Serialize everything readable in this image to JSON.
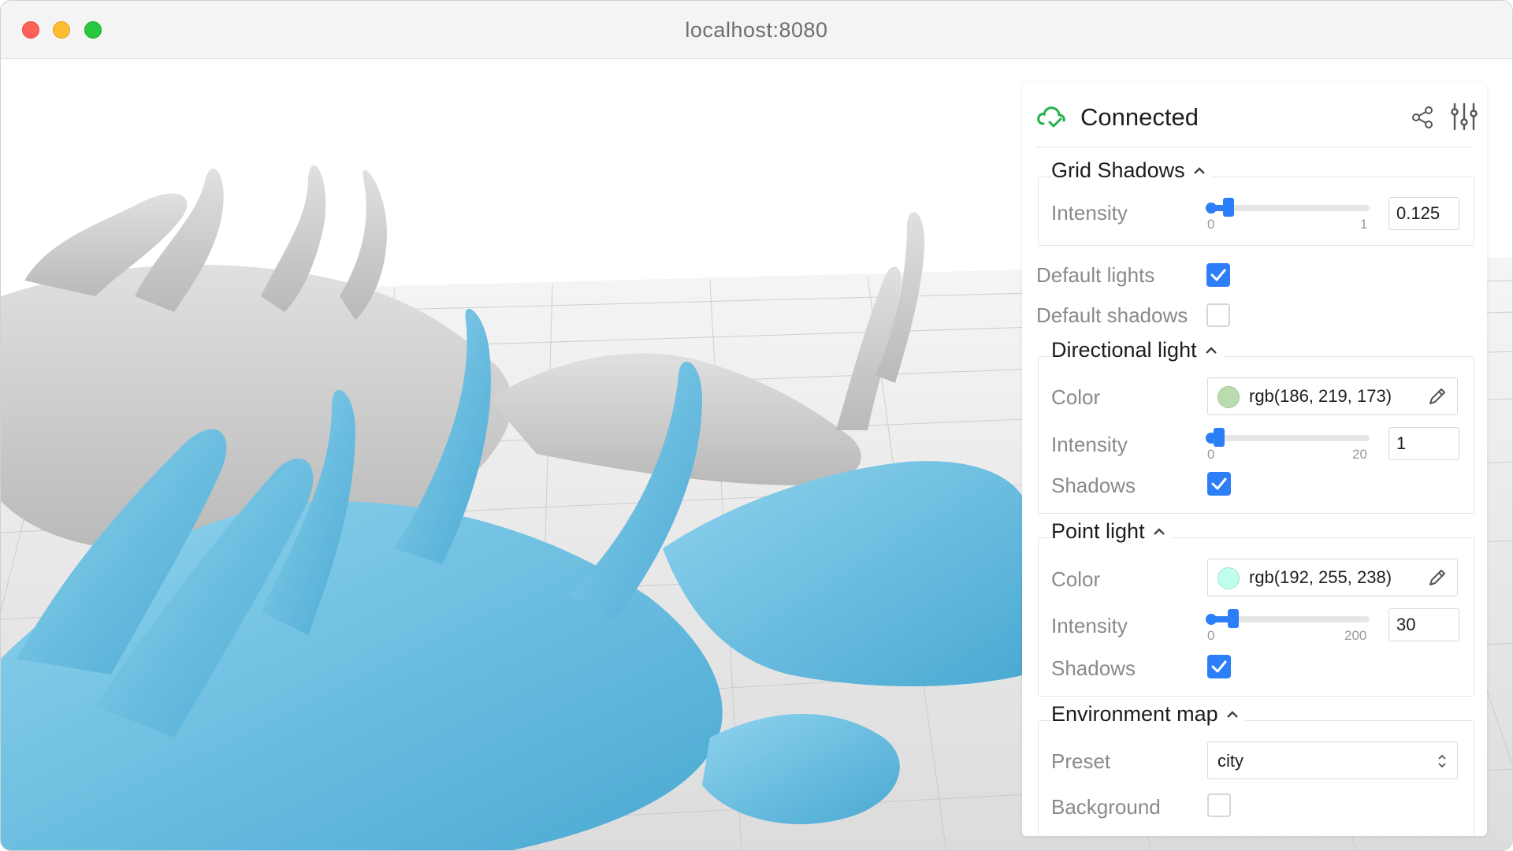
{
  "window": {
    "url": "localhost:8080"
  },
  "status": {
    "label": "Connected",
    "color": "#22b24c"
  },
  "grid_shadows": {
    "title": "Grid Shadows",
    "intensity": {
      "label": "Intensity",
      "min": "0",
      "max": "1",
      "value": "0.125",
      "fraction": 0.125
    }
  },
  "default_lights": {
    "label": "Default lights",
    "checked": true
  },
  "default_shadows": {
    "label": "Default shadows",
    "checked": false
  },
  "directional_light": {
    "title": "Directional light",
    "color": {
      "label": "Color",
      "value": "rgb(186, 219, 173)",
      "swatch": "#badbad"
    },
    "intensity": {
      "label": "Intensity",
      "min": "0",
      "max": "20",
      "value": "1",
      "fraction": 0.05
    },
    "shadows": {
      "label": "Shadows",
      "checked": true
    }
  },
  "point_light": {
    "title": "Point light",
    "color": {
      "label": "Color",
      "value": "rgb(192, 255, 238)",
      "swatch": "#c0ffee"
    },
    "intensity": {
      "label": "Intensity",
      "min": "0",
      "max": "200",
      "value": "30",
      "fraction": 0.15
    },
    "shadows": {
      "label": "Shadows",
      "checked": true
    }
  },
  "environment_map": {
    "title": "Environment map",
    "preset": {
      "label": "Preset",
      "value": "city"
    },
    "background": {
      "label": "Background",
      "checked": false
    }
  },
  "colors": {
    "accent": "#2d7ff9",
    "model_blue": "#7cc9e6",
    "model_gray": "#cfcfcf"
  }
}
